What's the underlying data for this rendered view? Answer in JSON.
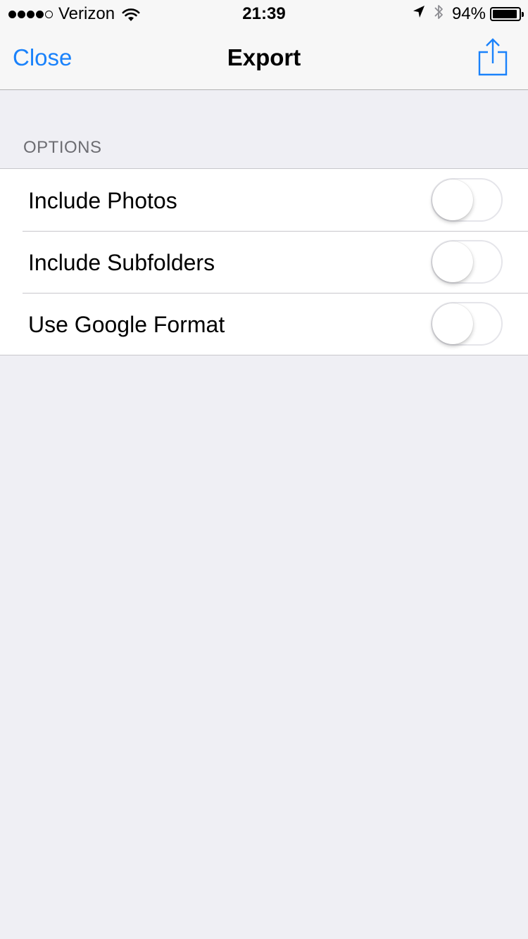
{
  "status_bar": {
    "carrier": "Verizon",
    "signal_bars_filled": 4,
    "signal_bars_total": 5,
    "time": "21:39",
    "battery_percent": "94%",
    "battery_level": 0.94,
    "icons": [
      "wifi-icon",
      "location-arrow-icon",
      "bluetooth-icon",
      "battery-icon"
    ]
  },
  "nav": {
    "close_label": "Close",
    "title": "Export",
    "share_icon": "share-icon"
  },
  "section": {
    "header": "OPTIONS"
  },
  "options": [
    {
      "label": "Include Photos",
      "enabled": false
    },
    {
      "label": "Include Subfolders",
      "enabled": false
    },
    {
      "label": "Use Google Format",
      "enabled": false
    }
  ],
  "colors": {
    "accent": "#1a82fb",
    "background": "#efeff4",
    "bar_background": "#f7f7f7",
    "section_header": "#6d6d72",
    "separator": "#c8c7cc"
  }
}
